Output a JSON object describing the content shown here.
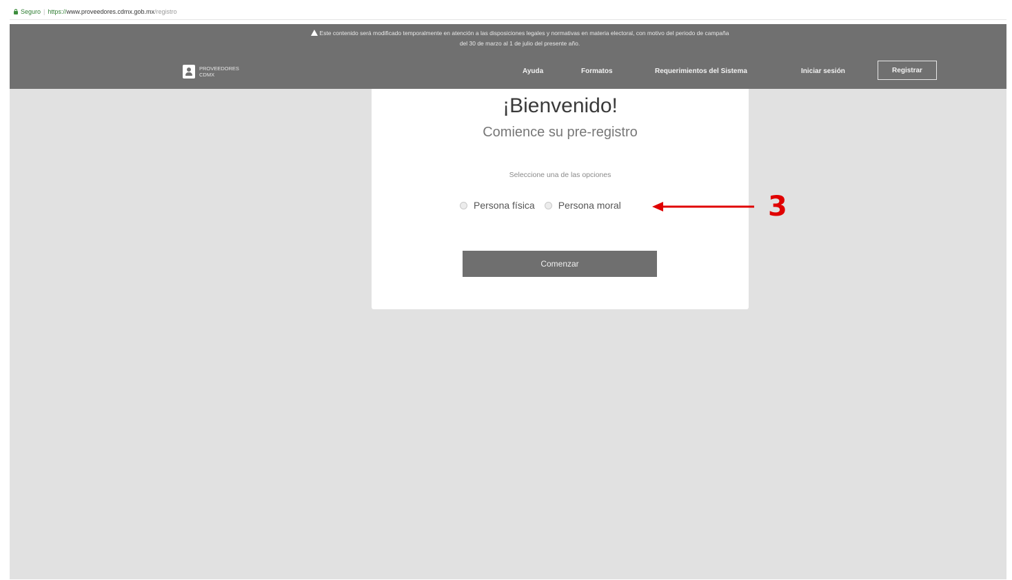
{
  "browser": {
    "secure_label": "Seguro",
    "url_scheme": "https://",
    "url_host": "www.proveedores.cdmx.gob.mx",
    "url_path": "/registro"
  },
  "header": {
    "notice_line1": "Este contenido será modificado temporalmente en atención a las disposiciones legales y normativas en materia electoral, con motivo del periodo de campaña",
    "notice_line2": "del 30 de marzo al 1 de julio del presente año.",
    "logo_line1": "PROVEEDORES",
    "logo_line2": "CDMX",
    "nav": {
      "ayuda": "Ayuda",
      "formatos": "Formatos",
      "requerimientos": "Requerimientos del Sistema",
      "iniciar_sesion": "Iniciar sesión",
      "registrar": "Registrar"
    }
  },
  "card": {
    "title": "¡Bienvenido!",
    "subtitle": "Comience su pre-registro",
    "instruction": "Seleccione una de las opciones",
    "options": [
      "Persona física",
      "Persona moral"
    ],
    "button": "Comenzar"
  },
  "annotation": {
    "number": "3",
    "color": "#e00000"
  }
}
